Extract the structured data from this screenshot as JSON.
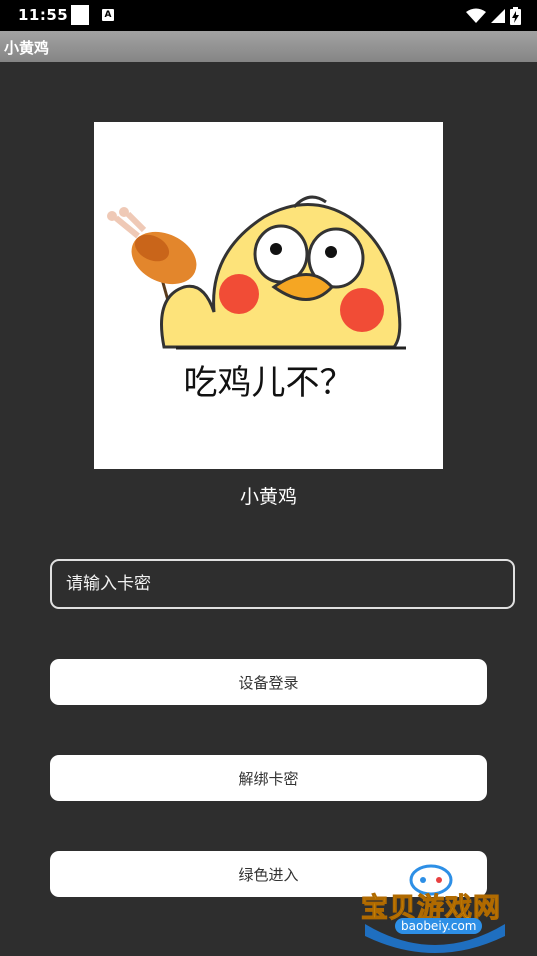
{
  "status_bar": {
    "time": "11:55",
    "notif_icon_letter": "A"
  },
  "app": {
    "title": "小黄鸡"
  },
  "logo": {
    "caption": "吃鸡儿不？"
  },
  "app_name": "小黄鸡",
  "card_input": {
    "placeholder": "请输入卡密",
    "value": ""
  },
  "buttons": {
    "device_login": "设备登录",
    "unbind_card": "解绑卡密",
    "green_enter": "绿色进入"
  },
  "watermark": {
    "text": "宝贝游戏网",
    "url": "baobeiy.com"
  },
  "colors": {
    "background": "#2e2e2e",
    "button": "#ffffff",
    "title_bar": "#969696"
  }
}
